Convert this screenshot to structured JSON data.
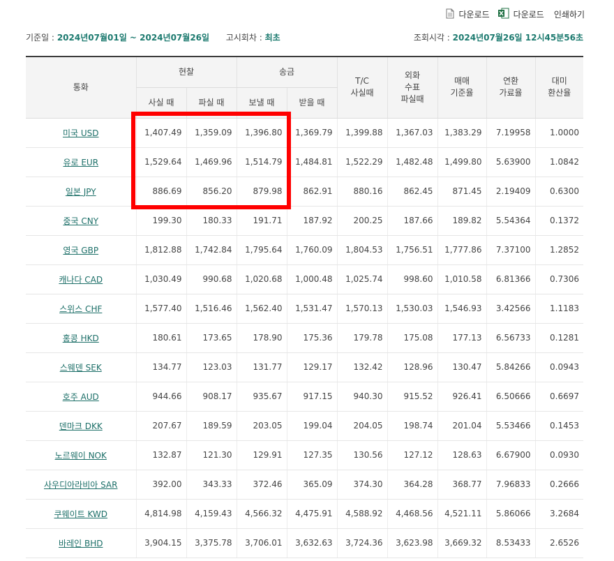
{
  "toolbar": {
    "download1_label": "다운로드",
    "download2_label": "다운로드",
    "print_label": "인쇄하기"
  },
  "info": {
    "base_date_label": "기준일 :",
    "base_date_value": "2024년07월01일 ~ 2024년07월26일",
    "notice_label": "고시회차 :",
    "notice_value": "최초",
    "query_label": "조회시각 :",
    "query_value": "2024년07월26일 12시45분56초"
  },
  "headers": {
    "currency": "통화",
    "cash": "현찰",
    "transfer": "송금",
    "tc_buy": "T/C\n사실때",
    "fx_check": "외화\n수표\n파실때",
    "base_rate": "매매\n기준율",
    "conv_rate": "연환\n가료율",
    "usd_rate": "대미\n환산율",
    "cash_buy": "사실 때",
    "cash_sell": "파실 때",
    "send": "보낼 때",
    "receive": "받을 때"
  },
  "rows": [
    {
      "currency": "미국 USD",
      "cash_buy": "1,407.49",
      "cash_sell": "1,359.09",
      "send": "1,396.80",
      "receive": "1,369.79",
      "tc": "1,399.88",
      "check": "1,367.03",
      "base": "1,383.29",
      "conv": "7.19958",
      "usd": "1.0000"
    },
    {
      "currency": "유로 EUR",
      "cash_buy": "1,529.64",
      "cash_sell": "1,469.96",
      "send": "1,514.79",
      "receive": "1,484.81",
      "tc": "1,522.29",
      "check": "1,482.48",
      "base": "1,499.80",
      "conv": "5.63900",
      "usd": "1.0842"
    },
    {
      "currency": "일본 JPY",
      "cash_buy": "886.69",
      "cash_sell": "856.20",
      "send": "879.98",
      "receive": "862.91",
      "tc": "880.16",
      "check": "862.45",
      "base": "871.45",
      "conv": "2.19409",
      "usd": "0.6300"
    },
    {
      "currency": "중국 CNY",
      "cash_buy": "199.30",
      "cash_sell": "180.33",
      "send": "191.71",
      "receive": "187.92",
      "tc": "200.25",
      "check": "187.66",
      "base": "189.82",
      "conv": "5.54364",
      "usd": "0.1372"
    },
    {
      "currency": "영국 GBP",
      "cash_buy": "1,812.88",
      "cash_sell": "1,742.84",
      "send": "1,795.64",
      "receive": "1,760.09",
      "tc": "1,804.53",
      "check": "1,756.51",
      "base": "1,777.86",
      "conv": "7.37100",
      "usd": "1.2852"
    },
    {
      "currency": "캐나다 CAD",
      "cash_buy": "1,030.49",
      "cash_sell": "990.68",
      "send": "1,020.68",
      "receive": "1,000.48",
      "tc": "1,025.74",
      "check": "998.60",
      "base": "1,010.58",
      "conv": "6.81366",
      "usd": "0.7306"
    },
    {
      "currency": "스위스 CHF",
      "cash_buy": "1,577.40",
      "cash_sell": "1,516.46",
      "send": "1,562.40",
      "receive": "1,531.47",
      "tc": "1,570.13",
      "check": "1,530.03",
      "base": "1,546.93",
      "conv": "3.42566",
      "usd": "1.1183"
    },
    {
      "currency": "홍콩 HKD",
      "cash_buy": "180.61",
      "cash_sell": "173.65",
      "send": "178.90",
      "receive": "175.36",
      "tc": "179.78",
      "check": "175.08",
      "base": "177.13",
      "conv": "6.56733",
      "usd": "0.1281"
    },
    {
      "currency": "스웨덴 SEK",
      "cash_buy": "134.77",
      "cash_sell": "123.03",
      "send": "131.77",
      "receive": "129.17",
      "tc": "132.42",
      "check": "128.96",
      "base": "130.47",
      "conv": "5.84266",
      "usd": "0.0943"
    },
    {
      "currency": "호주 AUD",
      "cash_buy": "944.66",
      "cash_sell": "908.17",
      "send": "935.67",
      "receive": "917.15",
      "tc": "940.30",
      "check": "915.52",
      "base": "926.41",
      "conv": "6.50666",
      "usd": "0.6697"
    },
    {
      "currency": "덴마크 DKK",
      "cash_buy": "207.67",
      "cash_sell": "189.59",
      "send": "203.05",
      "receive": "199.04",
      "tc": "204.05",
      "check": "198.74",
      "base": "201.04",
      "conv": "5.53466",
      "usd": "0.1453"
    },
    {
      "currency": "노르웨이 NOK",
      "cash_buy": "132.87",
      "cash_sell": "121.30",
      "send": "129.91",
      "receive": "127.35",
      "tc": "130.56",
      "check": "127.12",
      "base": "128.63",
      "conv": "6.67900",
      "usd": "0.0930"
    },
    {
      "currency": "사우디아라비아 SAR",
      "cash_buy": "392.00",
      "cash_sell": "343.33",
      "send": "372.46",
      "receive": "365.09",
      "tc": "374.30",
      "check": "364.28",
      "base": "368.77",
      "conv": "7.96833",
      "usd": "0.2666"
    },
    {
      "currency": "쿠웨이트 KWD",
      "cash_buy": "4,814.98",
      "cash_sell": "4,159.43",
      "send": "4,566.32",
      "receive": "4,475.91",
      "tc": "4,588.92",
      "check": "4,468.56",
      "base": "4,521.11",
      "conv": "5.86066",
      "usd": "3.2684"
    },
    {
      "currency": "바레인 BHD",
      "cash_buy": "3,904.15",
      "cash_sell": "3,375.78",
      "send": "3,706.01",
      "receive": "3,632.63",
      "tc": "3,724.36",
      "check": "3,623.98",
      "base": "3,669.32",
      "conv": "8.53433",
      "usd": "2.6526"
    }
  ],
  "highlight_color": "#ff0000",
  "accent_color": "#1c7a6f"
}
